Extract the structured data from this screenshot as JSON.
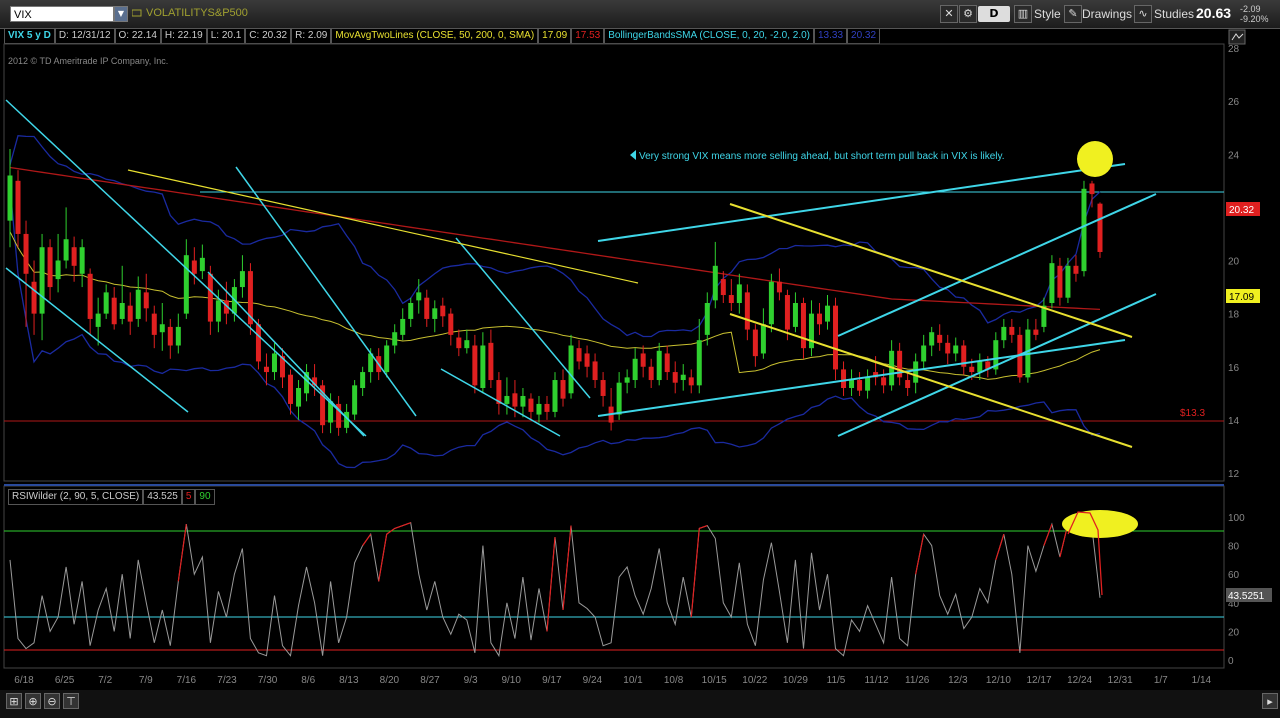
{
  "toolbar": {
    "symbol": "VIX",
    "description": "VOLATILITYS&P500",
    "period": "D",
    "style_label": "Style",
    "drawings_label": "Drawings",
    "studies_label": "Studies",
    "last_price": "20.63",
    "change": "-2.09",
    "change_pct": "-9.20%"
  },
  "indicators": {
    "symbol_period": "VIX 5 y D",
    "date": "D: 12/31/12",
    "open": "O: 22.14",
    "high": "H: 22.19",
    "low": "L: 20.1",
    "close": "C: 20.32",
    "range": "R: 2.09",
    "ma_label": "MovAvgTwoLines (CLOSE, 50, 200, 0, SMA)",
    "ma50": "17.09",
    "ma200": "17.53",
    "bb_label": "BollingerBandsSMA (CLOSE, 0, 20, -2.0, 2.0)",
    "bb_upper": "13.33",
    "bb_lower": "20.32"
  },
  "copyright": "2012 © TD Ameritrade IP Company, Inc.",
  "annotation": "Very strong VIX means more selling ahead, but short term pull back in VIX is likely.",
  "support_label": "$13.3",
  "rsi": {
    "label": "RSIWilder (2, 90, 5, CLOSE)",
    "value": "43.525",
    "oversold": "5",
    "overbought": "90",
    "current_tag": "43.5251"
  },
  "price_tags": {
    "last": "20.32",
    "ma": "17.09"
  },
  "colors": {
    "up": "#2fd02f",
    "down": "#e02020",
    "ma50": "#c8c030",
    "ma200": "#b01818",
    "bollinger": "#1a2aa0",
    "trendline_cyan": "#3fd6e8",
    "trendline_yellow": "#e8e030",
    "highlight": "#f0f020"
  },
  "chart_data": [
    {
      "type": "candlestick",
      "title": "VIX 5 y D",
      "ylim": [
        12,
        28
      ],
      "y_ticks": [
        12,
        14,
        16,
        18,
        20,
        22,
        24,
        26,
        28
      ],
      "x_ticks": [
        "6/18",
        "6/25",
        "7/2",
        "7/9",
        "7/16",
        "7/23",
        "7/30",
        "8/6",
        "8/13",
        "8/20",
        "8/27",
        "9/3",
        "9/10",
        "9/17",
        "9/24",
        "10/1",
        "10/8",
        "10/15",
        "10/22",
        "10/29",
        "11/5",
        "11/12",
        "11/26",
        "12/3",
        "12/10",
        "12/17",
        "12/24",
        "12/31",
        "1/7",
        "1/14"
      ],
      "candles": [
        {
          "o": 21.5,
          "c": 23.2,
          "h": 24.2,
          "l": 20.5
        },
        {
          "o": 23.0,
          "c": 21.0,
          "h": 23.4,
          "l": 20.5
        },
        {
          "o": 21.0,
          "c": 19.5,
          "h": 21.5,
          "l": 17.5
        },
        {
          "o": 19.2,
          "c": 18.0,
          "h": 20.0,
          "l": 17.2
        },
        {
          "o": 18.0,
          "c": 20.5,
          "h": 21.0,
          "l": 17.0
        },
        {
          "o": 20.5,
          "c": 19.0,
          "h": 20.8,
          "l": 18.5
        },
        {
          "o": 19.3,
          "c": 20.0,
          "h": 21.0,
          "l": 18.8
        },
        {
          "o": 20.0,
          "c": 20.8,
          "h": 22.0,
          "l": 19.7
        },
        {
          "o": 20.5,
          "c": 19.8,
          "h": 20.9,
          "l": 19.2
        },
        {
          "o": 19.5,
          "c": 20.5,
          "h": 20.8,
          "l": 19.0
        },
        {
          "o": 19.5,
          "c": 17.8,
          "h": 19.7,
          "l": 17.2
        },
        {
          "o": 17.5,
          "c": 18.0,
          "h": 18.6,
          "l": 16.8
        },
        {
          "o": 18.0,
          "c": 18.8,
          "h": 19.1,
          "l": 17.8
        },
        {
          "o": 18.6,
          "c": 17.6,
          "h": 19.0,
          "l": 17.4
        },
        {
          "o": 17.8,
          "c": 18.4,
          "h": 19.8,
          "l": 17.6
        },
        {
          "o": 18.3,
          "c": 17.7,
          "h": 18.8,
          "l": 17.2
        },
        {
          "o": 17.8,
          "c": 18.9,
          "h": 19.4,
          "l": 17.5
        },
        {
          "o": 18.8,
          "c": 18.2,
          "h": 19.5,
          "l": 17.7
        },
        {
          "o": 18.0,
          "c": 17.2,
          "h": 18.3,
          "l": 16.7
        },
        {
          "o": 17.3,
          "c": 17.6,
          "h": 18.4,
          "l": 16.6
        },
        {
          "o": 17.5,
          "c": 16.8,
          "h": 17.8,
          "l": 16.3
        },
        {
          "o": 16.8,
          "c": 17.5,
          "h": 18.0,
          "l": 16.5
        },
        {
          "o": 18.0,
          "c": 20.2,
          "h": 20.8,
          "l": 17.8
        },
        {
          "o": 20.0,
          "c": 19.5,
          "h": 20.5,
          "l": 19.1
        },
        {
          "o": 19.6,
          "c": 20.1,
          "h": 20.6,
          "l": 19.3
        },
        {
          "o": 19.5,
          "c": 17.7,
          "h": 19.8,
          "l": 17.2
        },
        {
          "o": 17.7,
          "c": 18.5,
          "h": 18.9,
          "l": 17.3
        },
        {
          "o": 18.5,
          "c": 18.0,
          "h": 19.2,
          "l": 17.6
        },
        {
          "o": 18.0,
          "c": 19.0,
          "h": 19.3,
          "l": 17.7
        },
        {
          "o": 19.0,
          "c": 19.6,
          "h": 20.2,
          "l": 18.6
        },
        {
          "o": 19.6,
          "c": 17.6,
          "h": 19.9,
          "l": 17.2
        },
        {
          "o": 17.6,
          "c": 16.2,
          "h": 17.8,
          "l": 15.9
        },
        {
          "o": 16.0,
          "c": 15.8,
          "h": 16.5,
          "l": 15.3
        },
        {
          "o": 15.8,
          "c": 16.5,
          "h": 16.9,
          "l": 15.5
        },
        {
          "o": 16.4,
          "c": 15.6,
          "h": 16.7,
          "l": 15.2
        },
        {
          "o": 15.7,
          "c": 14.6,
          "h": 15.9,
          "l": 14.2
        },
        {
          "o": 14.5,
          "c": 15.2,
          "h": 15.5,
          "l": 14.0
        },
        {
          "o": 15.0,
          "c": 15.8,
          "h": 16.1,
          "l": 14.7
        },
        {
          "o": 15.6,
          "c": 15.3,
          "h": 16.1,
          "l": 14.9
        },
        {
          "o": 15.3,
          "c": 13.8,
          "h": 15.5,
          "l": 13.5
        },
        {
          "o": 13.9,
          "c": 14.7,
          "h": 15.0,
          "l": 13.5
        },
        {
          "o": 14.6,
          "c": 13.7,
          "h": 14.9,
          "l": 13.4
        },
        {
          "o": 13.7,
          "c": 14.3,
          "h": 14.6,
          "l": 13.5
        },
        {
          "o": 14.2,
          "c": 15.3,
          "h": 15.5,
          "l": 14.0
        },
        {
          "o": 15.2,
          "c": 15.8,
          "h": 16.0,
          "l": 14.9
        },
        {
          "o": 15.8,
          "c": 16.5,
          "h": 16.7,
          "l": 15.4
        },
        {
          "o": 16.4,
          "c": 15.8,
          "h": 16.7,
          "l": 15.5
        },
        {
          "o": 15.8,
          "c": 16.8,
          "h": 17.0,
          "l": 15.6
        },
        {
          "o": 16.8,
          "c": 17.3,
          "h": 17.6,
          "l": 16.5
        },
        {
          "o": 17.2,
          "c": 17.8,
          "h": 18.2,
          "l": 17.0
        },
        {
          "o": 17.8,
          "c": 18.4,
          "h": 18.6,
          "l": 17.5
        },
        {
          "o": 18.5,
          "c": 18.8,
          "h": 19.3,
          "l": 18.0
        },
        {
          "o": 18.6,
          "c": 17.8,
          "h": 18.9,
          "l": 17.5
        },
        {
          "o": 17.8,
          "c": 18.2,
          "h": 18.5,
          "l": 17.3
        },
        {
          "o": 18.3,
          "c": 17.9,
          "h": 18.6,
          "l": 17.5
        },
        {
          "o": 18.0,
          "c": 17.2,
          "h": 18.2,
          "l": 16.8
        },
        {
          "o": 17.1,
          "c": 16.7,
          "h": 17.4,
          "l": 16.4
        },
        {
          "o": 16.7,
          "c": 17.0,
          "h": 17.4,
          "l": 16.5
        },
        {
          "o": 16.8,
          "c": 15.3,
          "h": 17.2,
          "l": 15.0
        },
        {
          "o": 15.2,
          "c": 16.8,
          "h": 17.3,
          "l": 15.0
        },
        {
          "o": 16.9,
          "c": 15.5,
          "h": 17.4,
          "l": 15.2
        },
        {
          "o": 15.5,
          "c": 14.6,
          "h": 15.8,
          "l": 14.2
        },
        {
          "o": 14.6,
          "c": 14.9,
          "h": 15.6,
          "l": 14.2
        },
        {
          "o": 15.0,
          "c": 14.5,
          "h": 15.5,
          "l": 14.1
        },
        {
          "o": 14.5,
          "c": 14.9,
          "h": 15.2,
          "l": 14.1
        },
        {
          "o": 14.8,
          "c": 14.3,
          "h": 15.0,
          "l": 14.0
        },
        {
          "o": 14.2,
          "c": 14.6,
          "h": 14.9,
          "l": 13.9
        },
        {
          "o": 14.6,
          "c": 14.3,
          "h": 14.9,
          "l": 14.0
        },
        {
          "o": 14.3,
          "c": 15.5,
          "h": 15.8,
          "l": 14.1
        },
        {
          "o": 15.5,
          "c": 14.8,
          "h": 15.9,
          "l": 14.5
        },
        {
          "o": 15.0,
          "c": 16.8,
          "h": 17.2,
          "l": 14.8
        },
        {
          "o": 16.7,
          "c": 16.2,
          "h": 17.0,
          "l": 15.9
        },
        {
          "o": 16.5,
          "c": 16.0,
          "h": 16.8,
          "l": 15.6
        },
        {
          "o": 16.2,
          "c": 15.5,
          "h": 16.5,
          "l": 15.2
        },
        {
          "o": 15.5,
          "c": 14.9,
          "h": 15.8,
          "l": 14.5
        },
        {
          "o": 14.5,
          "c": 13.9,
          "h": 15.2,
          "l": 13.6
        },
        {
          "o": 14.2,
          "c": 15.4,
          "h": 15.8,
          "l": 14.0
        },
        {
          "o": 15.4,
          "c": 15.6,
          "h": 15.9,
          "l": 15.0
        },
        {
          "o": 15.5,
          "c": 16.3,
          "h": 16.7,
          "l": 15.2
        },
        {
          "o": 16.5,
          "c": 16.0,
          "h": 16.8,
          "l": 15.6
        },
        {
          "o": 16.0,
          "c": 15.5,
          "h": 16.3,
          "l": 15.2
        },
        {
          "o": 15.5,
          "c": 16.6,
          "h": 16.9,
          "l": 15.3
        },
        {
          "o": 16.5,
          "c": 15.8,
          "h": 16.8,
          "l": 15.5
        },
        {
          "o": 15.8,
          "c": 15.4,
          "h": 16.2,
          "l": 15.0
        },
        {
          "o": 15.5,
          "c": 15.7,
          "h": 16.1,
          "l": 15.1
        },
        {
          "o": 15.6,
          "c": 15.3,
          "h": 15.9,
          "l": 15.0
        },
        {
          "o": 15.3,
          "c": 17.0,
          "h": 17.8,
          "l": 15.0
        },
        {
          "o": 17.2,
          "c": 18.4,
          "h": 18.8,
          "l": 16.8
        },
        {
          "o": 18.5,
          "c": 19.8,
          "h": 20.7,
          "l": 18.2
        },
        {
          "o": 19.3,
          "c": 18.7,
          "h": 19.6,
          "l": 18.4
        },
        {
          "o": 18.7,
          "c": 18.4,
          "h": 19.3,
          "l": 18.1
        },
        {
          "o": 18.4,
          "c": 19.1,
          "h": 19.5,
          "l": 18.0
        },
        {
          "o": 18.8,
          "c": 17.4,
          "h": 19.1,
          "l": 17.0
        },
        {
          "o": 17.4,
          "c": 16.4,
          "h": 17.6,
          "l": 16.0
        },
        {
          "o": 16.5,
          "c": 17.6,
          "h": 18.2,
          "l": 16.3
        },
        {
          "o": 17.6,
          "c": 19.2,
          "h": 19.5,
          "l": 17.3
        },
        {
          "o": 19.2,
          "c": 18.8,
          "h": 19.7,
          "l": 18.5
        },
        {
          "o": 18.7,
          "c": 17.4,
          "h": 18.9,
          "l": 17.0
        },
        {
          "o": 17.5,
          "c": 18.4,
          "h": 18.8,
          "l": 17.3
        },
        {
          "o": 18.4,
          "c": 16.7,
          "h": 18.6,
          "l": 16.3
        },
        {
          "o": 16.7,
          "c": 18.0,
          "h": 18.5,
          "l": 16.4
        },
        {
          "o": 18.0,
          "c": 17.6,
          "h": 18.4,
          "l": 17.2
        },
        {
          "o": 17.7,
          "c": 18.3,
          "h": 18.7,
          "l": 17.4
        },
        {
          "o": 18.3,
          "c": 15.9,
          "h": 18.6,
          "l": 15.5
        },
        {
          "o": 15.9,
          "c": 15.2,
          "h": 16.2,
          "l": 14.9
        },
        {
          "o": 15.2,
          "c": 15.5,
          "h": 15.9,
          "l": 14.9
        },
        {
          "o": 15.5,
          "c": 15.1,
          "h": 15.8,
          "l": 14.9
        },
        {
          "o": 15.1,
          "c": 15.6,
          "h": 15.9,
          "l": 14.8
        },
        {
          "o": 15.8,
          "c": 15.6,
          "h": 16.4,
          "l": 15.3
        },
        {
          "o": 15.6,
          "c": 15.3,
          "h": 15.9,
          "l": 15.0
        },
        {
          "o": 15.3,
          "c": 16.6,
          "h": 17.0,
          "l": 15.1
        },
        {
          "o": 16.6,
          "c": 15.6,
          "h": 16.9,
          "l": 15.3
        },
        {
          "o": 15.5,
          "c": 15.2,
          "h": 15.8,
          "l": 14.9
        },
        {
          "o": 15.4,
          "c": 16.2,
          "h": 16.5,
          "l": 15.0
        },
        {
          "o": 16.2,
          "c": 16.8,
          "h": 17.2,
          "l": 15.9
        },
        {
          "o": 16.8,
          "c": 17.3,
          "h": 17.5,
          "l": 16.4
        },
        {
          "o": 17.2,
          "c": 16.9,
          "h": 17.6,
          "l": 16.6
        },
        {
          "o": 16.9,
          "c": 16.5,
          "h": 17.2,
          "l": 16.1
        },
        {
          "o": 16.5,
          "c": 16.8,
          "h": 17.1,
          "l": 16.2
        },
        {
          "o": 16.8,
          "c": 16.0,
          "h": 17.0,
          "l": 15.7
        },
        {
          "o": 16.0,
          "c": 15.8,
          "h": 16.3,
          "l": 15.5
        },
        {
          "o": 15.8,
          "c": 16.2,
          "h": 16.5,
          "l": 15.5
        },
        {
          "o": 16.2,
          "c": 15.9,
          "h": 16.4,
          "l": 15.6
        },
        {
          "o": 15.9,
          "c": 17.0,
          "h": 17.3,
          "l": 15.7
        },
        {
          "o": 17.0,
          "c": 17.5,
          "h": 17.8,
          "l": 16.7
        },
        {
          "o": 17.5,
          "c": 17.2,
          "h": 17.8,
          "l": 16.9
        },
        {
          "o": 17.2,
          "c": 15.6,
          "h": 17.5,
          "l": 15.4
        },
        {
          "o": 15.6,
          "c": 17.4,
          "h": 17.8,
          "l": 15.4
        },
        {
          "o": 17.4,
          "c": 17.2,
          "h": 17.8,
          "l": 17.0
        },
        {
          "o": 17.5,
          "c": 18.3,
          "h": 18.6,
          "l": 17.3
        },
        {
          "o": 18.4,
          "c": 19.9,
          "h": 20.2,
          "l": 18.2
        },
        {
          "o": 19.8,
          "c": 18.6,
          "h": 20.1,
          "l": 18.3
        },
        {
          "o": 18.6,
          "c": 19.8,
          "h": 20.1,
          "l": 18.4
        },
        {
          "o": 19.8,
          "c": 19.5,
          "h": 20.2,
          "l": 19.2
        },
        {
          "o": 19.6,
          "c": 22.7,
          "h": 23.0,
          "l": 19.4
        },
        {
          "o": 22.9,
          "c": 22.5,
          "h": 23.0,
          "l": 22.0
        },
        {
          "o": 22.14,
          "c": 20.32,
          "h": 22.19,
          "l": 20.1
        }
      ]
    },
    {
      "type": "line",
      "title": "RSIWilder (2, 90, 5, CLOSE)",
      "ylim": [
        0,
        100
      ],
      "y_ticks": [
        0,
        20,
        40,
        60,
        80,
        100
      ],
      "levels": [
        5,
        90
      ],
      "values": [
        70,
        15,
        8,
        12,
        45,
        20,
        30,
        65,
        25,
        55,
        10,
        35,
        50,
        20,
        60,
        15,
        70,
        40,
        12,
        35,
        10,
        55,
        95,
        60,
        72,
        12,
        48,
        30,
        60,
        78,
        15,
        5,
        3,
        45,
        10,
        3,
        38,
        65,
        40,
        3,
        55,
        12,
        30,
        68,
        80,
        88,
        55,
        88,
        92,
        94,
        96,
        60,
        35,
        55,
        30,
        18,
        32,
        28,
        5,
        80,
        12,
        3,
        40,
        15,
        58,
        14,
        50,
        20,
        86,
        35,
        94,
        40,
        36,
        30,
        10,
        12,
        58,
        65,
        45,
        32,
        50,
        78,
        40,
        25,
        58,
        30,
        92,
        94,
        85,
        40,
        30,
        68,
        25,
        10,
        56,
        82,
        48,
        12,
        70,
        8,
        75,
        35,
        60,
        8,
        3,
        28,
        20,
        38,
        25,
        12,
        58,
        15,
        10,
        60,
        88,
        80,
        45,
        32,
        46,
        22,
        30,
        50,
        40,
        70,
        88,
        60,
        5,
        80,
        62,
        80,
        95,
        72,
        95,
        88,
        96,
        92,
        43.5
      ]
    }
  ]
}
